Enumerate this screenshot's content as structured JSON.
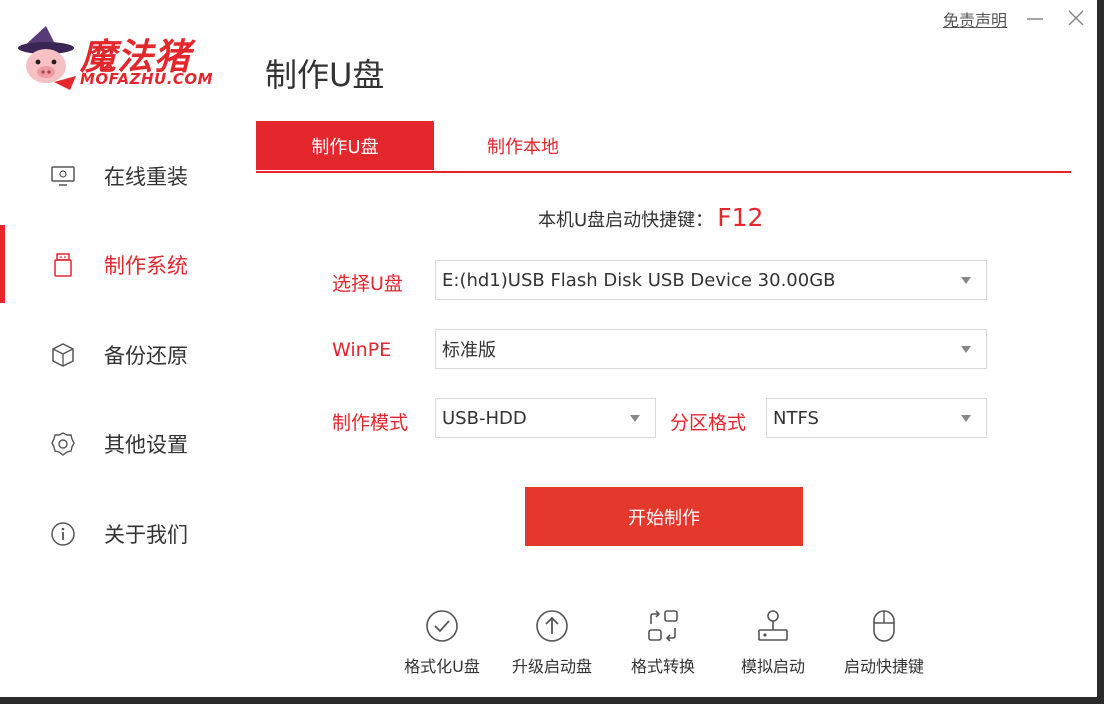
{
  "app": {
    "brand_cn": "魔法猪",
    "brand_en": "MOFAZHU.COM",
    "title": "制作U盘",
    "disclaimer": "免责声明"
  },
  "sidebar": {
    "items": [
      {
        "label": "在线重装",
        "icon": "monitor-icon"
      },
      {
        "label": "制作系统",
        "icon": "usb-drive-icon",
        "active": true
      },
      {
        "label": "备份还原",
        "icon": "cube-icon"
      },
      {
        "label": "其他设置",
        "icon": "gear-icon"
      },
      {
        "label": "关于我们",
        "icon": "info-icon"
      }
    ]
  },
  "tabs": [
    {
      "label": "制作U盘",
      "active": true
    },
    {
      "label": "制作本地"
    }
  ],
  "hotkey": {
    "label": "本机U盘启动快捷键：",
    "value": "F12"
  },
  "form": {
    "usb": {
      "label": "选择U盘",
      "value": "E:(hd1)USB Flash Disk USB Device 30.00GB"
    },
    "winpe": {
      "label": "WinPE",
      "value": "标准版"
    },
    "mode": {
      "label": "制作模式",
      "value": "USB-HDD"
    },
    "partition": {
      "label": "分区格式",
      "value": "NTFS"
    }
  },
  "start_button": "开始制作",
  "tools": [
    {
      "label": "格式化U盘",
      "icon": "check-circle-icon"
    },
    {
      "label": "升级启动盘",
      "icon": "upload-circle-icon"
    },
    {
      "label": "格式转换",
      "icon": "convert-icon"
    },
    {
      "label": "模拟启动",
      "icon": "joystick-icon"
    },
    {
      "label": "启动快捷键",
      "icon": "mouse-icon"
    }
  ],
  "colors": {
    "accent": "#e4262d",
    "text": "#333333",
    "border": "#d9d9d9"
  }
}
